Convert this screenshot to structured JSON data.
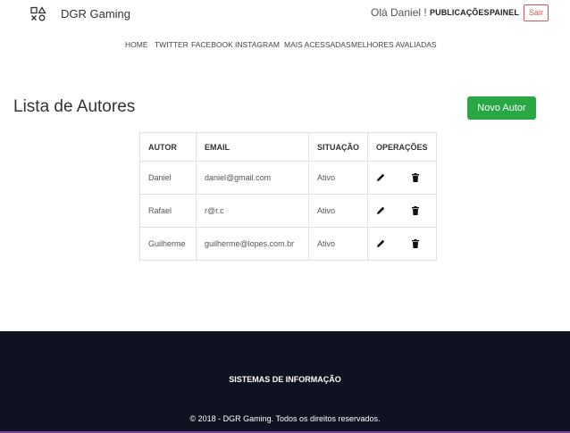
{
  "header": {
    "brand": "DGR Gaming",
    "logo_icon": "playstation-symbols-icon",
    "greeting": "Olá Daniel !",
    "nav": {
      "publicacoes": "PUBLICAÇÕES",
      "painel": "PAINEL",
      "logout": "Sair"
    }
  },
  "subnav": {
    "items": [
      "HOME",
      "TWITTER",
      "FACEBOOK",
      "INSTAGRAM",
      "MAIS ACESSADAS",
      "MELHORES AVALIADAS"
    ]
  },
  "main": {
    "title": "Lista de Autores",
    "new_button": "Novo Autor",
    "table": {
      "headers": [
        "AUTOR",
        "EMAIL",
        "SITUAÇÃO",
        "OPERAÇÕES"
      ],
      "rows": [
        [
          "Daniel",
          "daniel@gmail.com",
          "Ativo"
        ],
        [
          "Rafael",
          "r@r.c",
          "Ativo"
        ],
        [
          "Guilherme",
          "guilherme@lopes.com.br",
          "Ativo"
        ]
      ],
      "operation_icons": [
        "pencil-icon",
        "trash-icon"
      ]
    }
  },
  "footer": {
    "title": "SISTEMAS DE INFORMAÇÃO",
    "copyright": "© 2018 - DGR Gaming. Todos os direitos reservados."
  },
  "colors": {
    "accent_green": "#28a745",
    "logout_red": "#d9534f",
    "footer_bg": "#0f1220",
    "footer_line": "#7b3fa0"
  }
}
